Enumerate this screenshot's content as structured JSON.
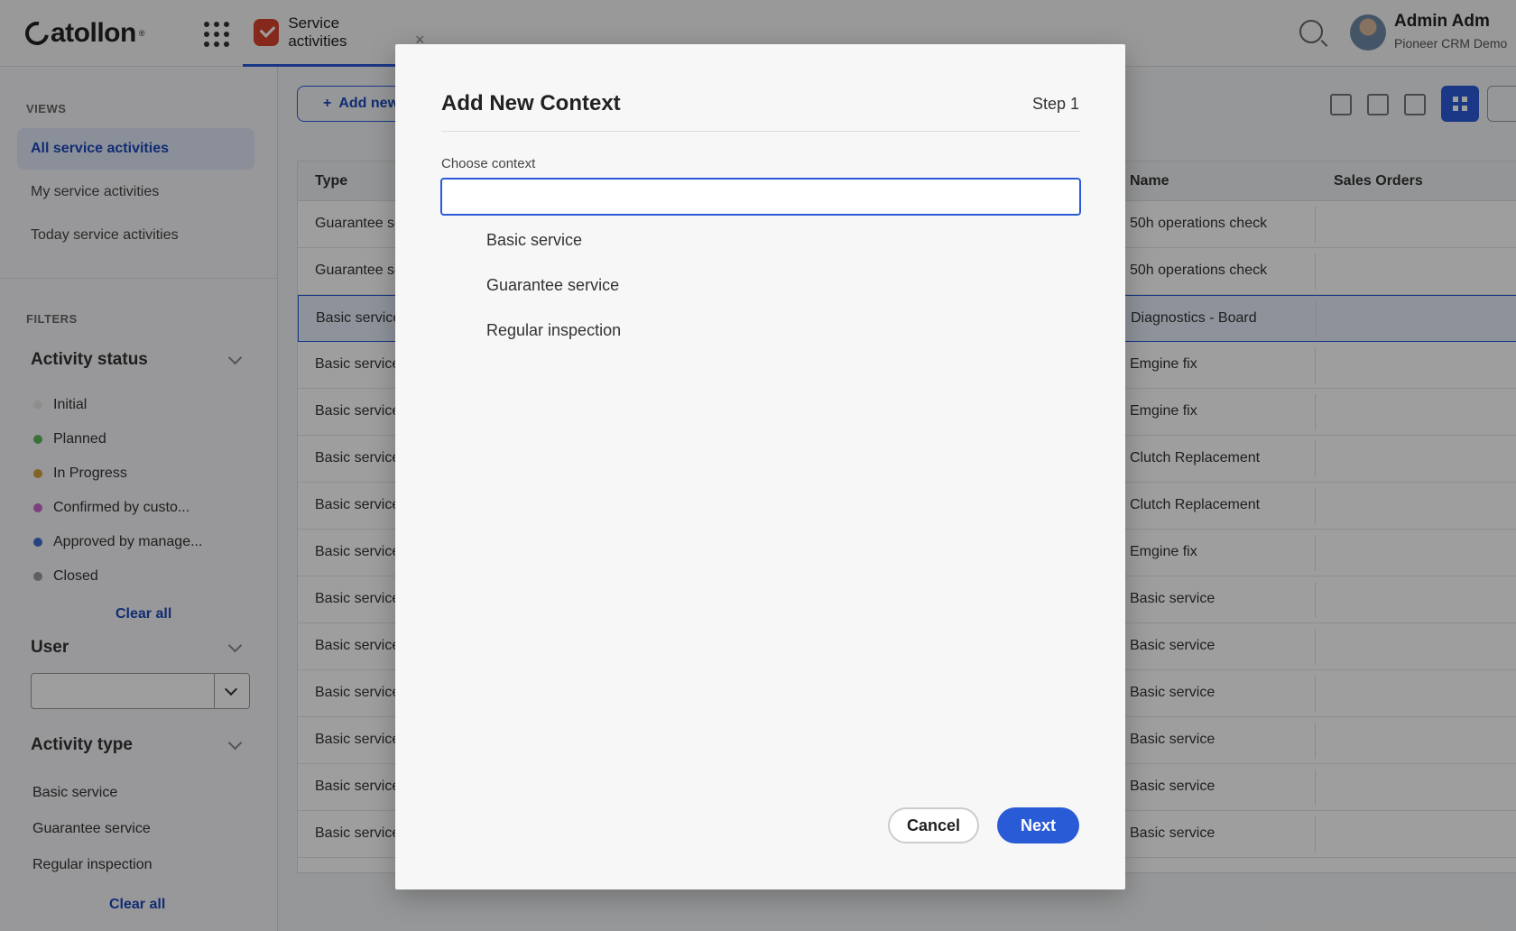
{
  "app": {
    "logo_text": "atollon",
    "tab_label": "Service activities",
    "tab_close": "×",
    "user_name": "Admin Adm",
    "user_org": "Pioneer CRM Demo"
  },
  "sidebar": {
    "views_caption": "VIEWS",
    "views": [
      "All service activities",
      "My service activities",
      "Today service activities"
    ],
    "filters_caption": "FILTERS",
    "activity_status": {
      "title": "Activity status",
      "items": [
        {
          "label": "Initial",
          "color": "#e6e6e6"
        },
        {
          "label": "Planned",
          "color": "#5cb85c"
        },
        {
          "label": "In Progress",
          "color": "#d4a23a"
        },
        {
          "label": "Confirmed by custo...",
          "color": "#c86ac8"
        },
        {
          "label": "Approved by manage...",
          "color": "#3f6fd1"
        },
        {
          "label": "Closed",
          "color": "#9a9a9a"
        }
      ],
      "clear_label": "Clear all"
    },
    "user_filter": {
      "title": "User",
      "value": ""
    },
    "activity_type": {
      "title": "Activity type",
      "items": [
        "Basic service",
        "Guarantee service",
        "Regular inspection"
      ],
      "clear_label": "Clear all"
    }
  },
  "main": {
    "add_button": "Add new",
    "columns": {
      "type": "Type",
      "name": "Name",
      "sales_orders": "Sales Orders"
    },
    "rows": [
      {
        "type": "Guarantee se",
        "name": "50h operations check",
        "selected": false
      },
      {
        "type": "Guarantee se",
        "name": "50h operations check",
        "selected": false
      },
      {
        "type": "Basic service",
        "name": "Diagnostics - Board",
        "selected": true
      },
      {
        "type": "Basic service",
        "name": "Emgine fix",
        "selected": false
      },
      {
        "type": "Basic service",
        "name": "Emgine fix",
        "selected": false
      },
      {
        "type": "Basic service",
        "name": "Clutch Replacement",
        "selected": false
      },
      {
        "type": "Basic service",
        "name": "Clutch Replacement",
        "selected": false
      },
      {
        "type": "Basic service",
        "name": "Emgine fix",
        "selected": false
      },
      {
        "type": "Basic service",
        "name": "Basic service",
        "selected": false
      },
      {
        "type": "Basic service",
        "name": "Basic service",
        "selected": false
      },
      {
        "type": "Basic service",
        "name": "Basic service",
        "selected": false
      },
      {
        "type": "Basic service",
        "name": "Basic service",
        "selected": false
      },
      {
        "type": "Basic service",
        "name": "Basic service",
        "selected": false
      },
      {
        "type": "Basic service",
        "name": "Basic service",
        "selected": false
      }
    ]
  },
  "modal": {
    "title": "Add New Context",
    "step": "Step 1",
    "field_label": "Choose context",
    "input_value": "",
    "options": [
      "Basic service",
      "Guarantee service",
      "Regular inspection"
    ],
    "cancel_label": "Cancel",
    "next_label": "Next"
  }
}
